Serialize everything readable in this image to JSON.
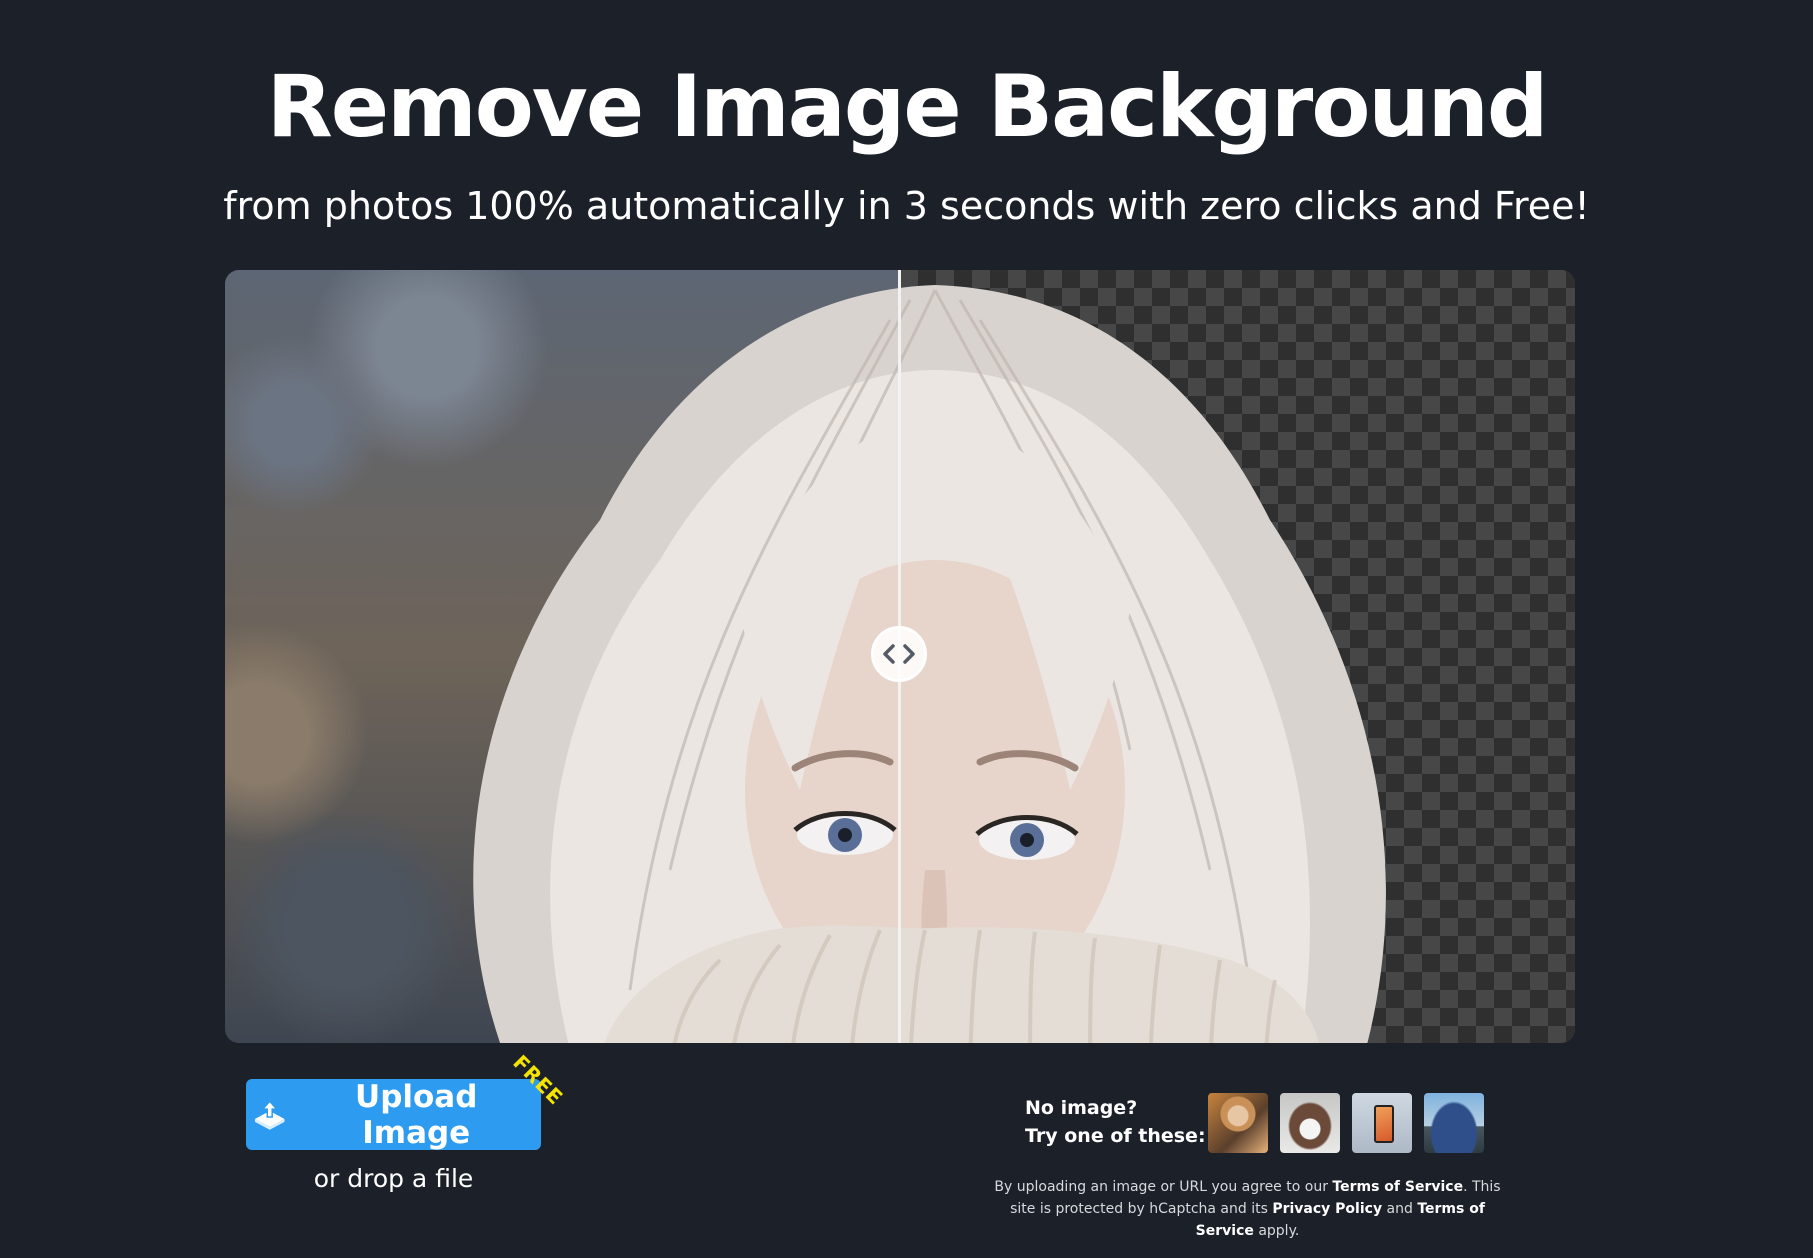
{
  "hero": {
    "title": "Remove Image Background",
    "subtitle": "from photos 100% automatically in 3 seconds with zero clicks and Free!"
  },
  "comparison": {
    "before_alt": "Original photo",
    "after_alt": "Background removed",
    "divider_position": 0.5
  },
  "upload": {
    "button_label": "Upload Image",
    "badge": "FREE",
    "drop_hint": "or drop a file"
  },
  "samples": {
    "prompt_line1": "No image?",
    "prompt_line2": "Try one of these:",
    "thumbnails": [
      "person",
      "dog",
      "phone",
      "car"
    ]
  },
  "legal": {
    "text1": "By uploading an image or URL you agree to our ",
    "terms_link": "Terms of Service",
    "text2": ". This site is protected by hCaptcha and its ",
    "privacy_link": "Privacy Policy",
    "text3": " and ",
    "terms_link2": "Terms of Service",
    "text4": " apply."
  },
  "colors": {
    "background": "#1b2029",
    "primary_button": "#2d9bf0",
    "badge": "#f5e400"
  },
  "icons": {
    "upload": "upload-icon",
    "slider": "compare-arrows-icon"
  }
}
